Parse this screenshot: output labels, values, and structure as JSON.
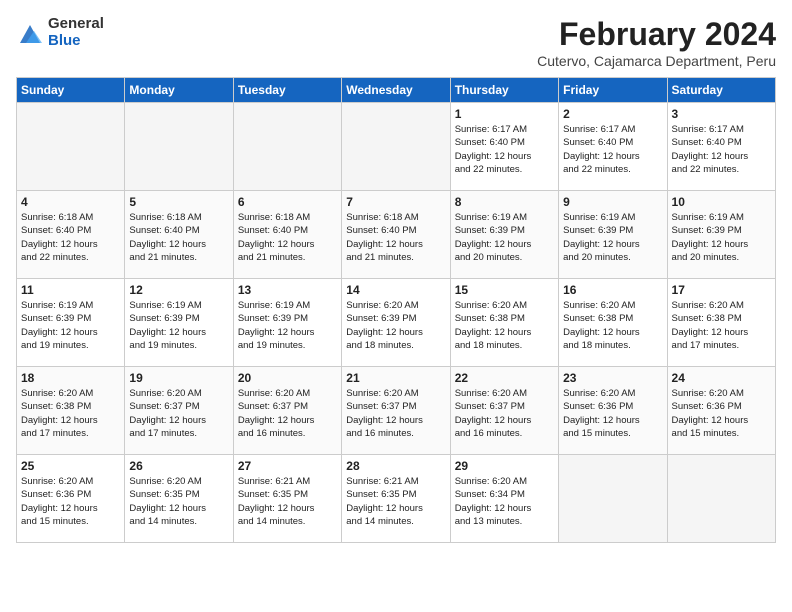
{
  "header": {
    "logo_general": "General",
    "logo_blue": "Blue",
    "main_title": "February 2024",
    "sub_title": "Cutervo, Cajamarca Department, Peru"
  },
  "days_of_week": [
    "Sunday",
    "Monday",
    "Tuesday",
    "Wednesday",
    "Thursday",
    "Friday",
    "Saturday"
  ],
  "weeks": [
    [
      {
        "day": "",
        "info": "",
        "empty": true
      },
      {
        "day": "",
        "info": "",
        "empty": true
      },
      {
        "day": "",
        "info": "",
        "empty": true
      },
      {
        "day": "",
        "info": "",
        "empty": true
      },
      {
        "day": "1",
        "info": "Sunrise: 6:17 AM\nSunset: 6:40 PM\nDaylight: 12 hours\nand 22 minutes."
      },
      {
        "day": "2",
        "info": "Sunrise: 6:17 AM\nSunset: 6:40 PM\nDaylight: 12 hours\nand 22 minutes."
      },
      {
        "day": "3",
        "info": "Sunrise: 6:17 AM\nSunset: 6:40 PM\nDaylight: 12 hours\nand 22 minutes."
      }
    ],
    [
      {
        "day": "4",
        "info": "Sunrise: 6:18 AM\nSunset: 6:40 PM\nDaylight: 12 hours\nand 22 minutes."
      },
      {
        "day": "5",
        "info": "Sunrise: 6:18 AM\nSunset: 6:40 PM\nDaylight: 12 hours\nand 21 minutes."
      },
      {
        "day": "6",
        "info": "Sunrise: 6:18 AM\nSunset: 6:40 PM\nDaylight: 12 hours\nand 21 minutes."
      },
      {
        "day": "7",
        "info": "Sunrise: 6:18 AM\nSunset: 6:40 PM\nDaylight: 12 hours\nand 21 minutes."
      },
      {
        "day": "8",
        "info": "Sunrise: 6:19 AM\nSunset: 6:39 PM\nDaylight: 12 hours\nand 20 minutes."
      },
      {
        "day": "9",
        "info": "Sunrise: 6:19 AM\nSunset: 6:39 PM\nDaylight: 12 hours\nand 20 minutes."
      },
      {
        "day": "10",
        "info": "Sunrise: 6:19 AM\nSunset: 6:39 PM\nDaylight: 12 hours\nand 20 minutes."
      }
    ],
    [
      {
        "day": "11",
        "info": "Sunrise: 6:19 AM\nSunset: 6:39 PM\nDaylight: 12 hours\nand 19 minutes."
      },
      {
        "day": "12",
        "info": "Sunrise: 6:19 AM\nSunset: 6:39 PM\nDaylight: 12 hours\nand 19 minutes."
      },
      {
        "day": "13",
        "info": "Sunrise: 6:19 AM\nSunset: 6:39 PM\nDaylight: 12 hours\nand 19 minutes."
      },
      {
        "day": "14",
        "info": "Sunrise: 6:20 AM\nSunset: 6:39 PM\nDaylight: 12 hours\nand 18 minutes."
      },
      {
        "day": "15",
        "info": "Sunrise: 6:20 AM\nSunset: 6:38 PM\nDaylight: 12 hours\nand 18 minutes."
      },
      {
        "day": "16",
        "info": "Sunrise: 6:20 AM\nSunset: 6:38 PM\nDaylight: 12 hours\nand 18 minutes."
      },
      {
        "day": "17",
        "info": "Sunrise: 6:20 AM\nSunset: 6:38 PM\nDaylight: 12 hours\nand 17 minutes."
      }
    ],
    [
      {
        "day": "18",
        "info": "Sunrise: 6:20 AM\nSunset: 6:38 PM\nDaylight: 12 hours\nand 17 minutes."
      },
      {
        "day": "19",
        "info": "Sunrise: 6:20 AM\nSunset: 6:37 PM\nDaylight: 12 hours\nand 17 minutes."
      },
      {
        "day": "20",
        "info": "Sunrise: 6:20 AM\nSunset: 6:37 PM\nDaylight: 12 hours\nand 16 minutes."
      },
      {
        "day": "21",
        "info": "Sunrise: 6:20 AM\nSunset: 6:37 PM\nDaylight: 12 hours\nand 16 minutes."
      },
      {
        "day": "22",
        "info": "Sunrise: 6:20 AM\nSunset: 6:37 PM\nDaylight: 12 hours\nand 16 minutes."
      },
      {
        "day": "23",
        "info": "Sunrise: 6:20 AM\nSunset: 6:36 PM\nDaylight: 12 hours\nand 15 minutes."
      },
      {
        "day": "24",
        "info": "Sunrise: 6:20 AM\nSunset: 6:36 PM\nDaylight: 12 hours\nand 15 minutes."
      }
    ],
    [
      {
        "day": "25",
        "info": "Sunrise: 6:20 AM\nSunset: 6:36 PM\nDaylight: 12 hours\nand 15 minutes."
      },
      {
        "day": "26",
        "info": "Sunrise: 6:20 AM\nSunset: 6:35 PM\nDaylight: 12 hours\nand 14 minutes."
      },
      {
        "day": "27",
        "info": "Sunrise: 6:21 AM\nSunset: 6:35 PM\nDaylight: 12 hours\nand 14 minutes."
      },
      {
        "day": "28",
        "info": "Sunrise: 6:21 AM\nSunset: 6:35 PM\nDaylight: 12 hours\nand 14 minutes."
      },
      {
        "day": "29",
        "info": "Sunrise: 6:20 AM\nSunset: 6:34 PM\nDaylight: 12 hours\nand 13 minutes."
      },
      {
        "day": "",
        "info": "",
        "empty": true
      },
      {
        "day": "",
        "info": "",
        "empty": true
      }
    ]
  ]
}
